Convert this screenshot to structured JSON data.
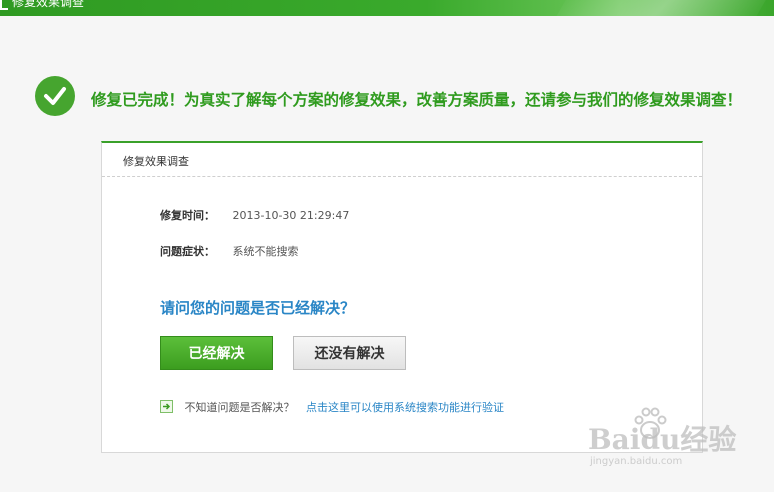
{
  "window": {
    "title": "修复效果调查"
  },
  "banner": {
    "message": "修复已完成！为真实了解每个方案的修复效果，改善方案质量，还请参与我们的修复效果调查！"
  },
  "panel": {
    "title": "修复效果调查",
    "info": [
      {
        "label": "修复时间：",
        "value": "2013-10-30 21:29:47"
      },
      {
        "label": "问题症状：",
        "value": "系统不能搜索"
      }
    ],
    "question": "请问您的问题是否已经解决？",
    "buttons": {
      "solved": "已经解决",
      "unsolved": "还没有解决"
    },
    "verify": {
      "question": "不知道问题是否解决？",
      "link": "点击这里可以使用系统搜索功能进行验证"
    }
  },
  "watermark": {
    "logo": "Baidu经验",
    "url": "jingyan.baidu.com"
  },
  "colors": {
    "brand_green": "#3aa12a",
    "banner_text": "#2f9b1e",
    "question_blue": "#2a86c6",
    "link_blue": "#2a86c6"
  },
  "icons": [
    "checkmark-icon",
    "arrow-right-icon",
    "app-icon",
    "baidu-paw-icon"
  ]
}
